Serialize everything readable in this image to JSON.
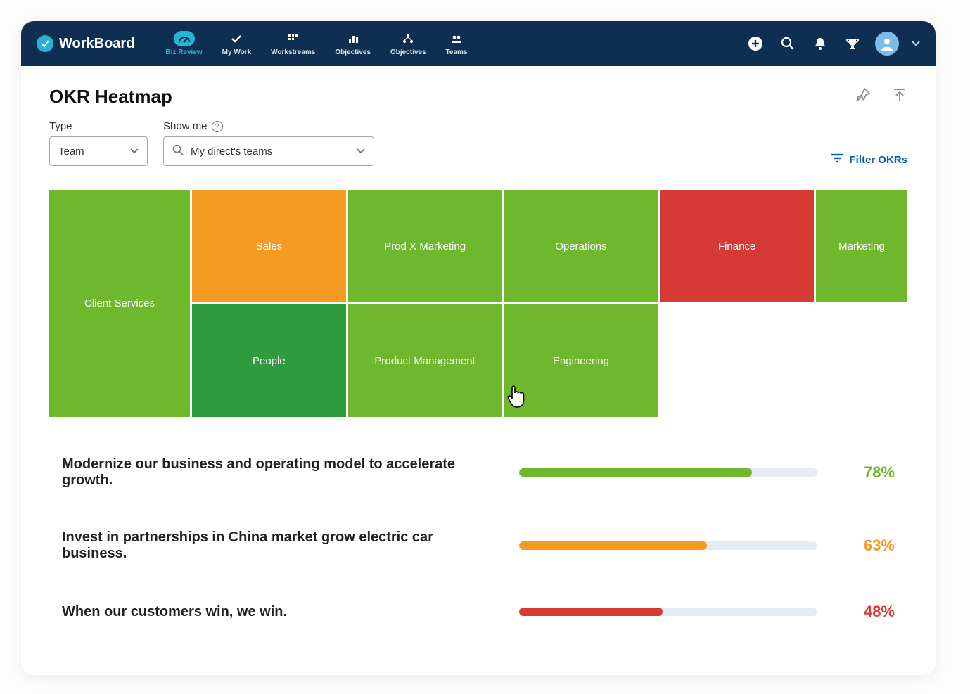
{
  "app_name": "WorkBoard",
  "nav": [
    {
      "label": "Biz Review",
      "icon": "gauge",
      "active": true
    },
    {
      "label": "My Work",
      "icon": "check"
    },
    {
      "label": "Workstreams",
      "icon": "grid"
    },
    {
      "label": "Objectives",
      "icon": "bars"
    },
    {
      "label": "Objectives",
      "icon": "branch"
    },
    {
      "label": "Teams",
      "icon": "people"
    }
  ],
  "page": {
    "title": "OKR Heatmap",
    "filters": {
      "type_label": "Type",
      "type_value": "Team",
      "showme_label": "Show me",
      "showme_value": "My direct's teams",
      "filter_label": "Filter OKRs"
    }
  },
  "heatmap": {
    "tiles": [
      {
        "name": "Sales",
        "color": "#f59a23"
      },
      {
        "name": "Prod X Marketing",
        "color": "#6fb82e"
      },
      {
        "name": "Operations",
        "color": "#6fb82e"
      },
      {
        "name": "Finance",
        "color": "#d73a35"
      },
      {
        "name": "Client Services",
        "color": "#6fb82e",
        "span": 2
      },
      {
        "name": "Marketing",
        "color": "#6fb82e"
      },
      {
        "name": "People",
        "color": "#2f9b3c"
      },
      {
        "name": "Product Management",
        "color": "#6fb82e"
      },
      {
        "name": "Engineering",
        "color": "#6fb82e"
      }
    ]
  },
  "objectives": [
    {
      "text": "Modernize our business and operating model to accelerate growth.",
      "pct": 78,
      "color": "#6fb82e"
    },
    {
      "text": "Invest in partnerships in China market grow electric car business.",
      "pct": 63,
      "color": "#f59a23"
    },
    {
      "text": "When our customers win, we win.",
      "pct": 48,
      "color": "#d73a35"
    }
  ],
  "chart_data": {
    "type": "heatmap",
    "title": "OKR Heatmap",
    "categories": [
      "Sales",
      "Prod X Marketing",
      "Operations",
      "Finance",
      "Client Services",
      "Marketing",
      "People",
      "Product Management",
      "Engineering"
    ],
    "status_colors": {
      "Sales": "orange",
      "Prod X Marketing": "green",
      "Operations": "green",
      "Finance": "red",
      "Client Services": "green",
      "Marketing": "green",
      "People": "dark-green",
      "Product Management": "green",
      "Engineering": "green"
    },
    "objective_progress": [
      {
        "objective": "Modernize our business and operating model to accelerate growth.",
        "value": 78
      },
      {
        "objective": "Invest in partnerships in China market grow electric car business.",
        "value": 63
      },
      {
        "objective": "When our customers win, we win.",
        "value": 48
      }
    ],
    "ylim": [
      0,
      100
    ]
  }
}
